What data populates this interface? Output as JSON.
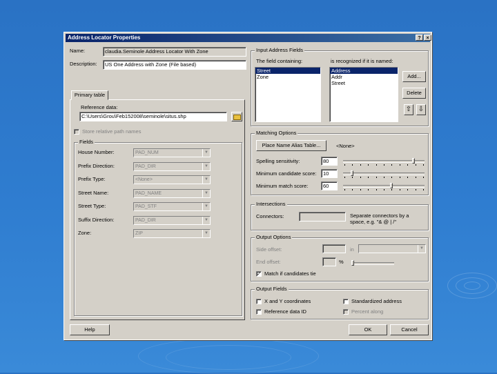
{
  "window": {
    "title": "Address Locator Properties",
    "help_btn": "?",
    "close_btn": "×"
  },
  "name": {
    "label": "Name:",
    "value": "claudia.Seminole Address Locator With Zone"
  },
  "description": {
    "label": "Description:",
    "value": "US One Address with Zone (File based)"
  },
  "tab": {
    "label": "Primary table"
  },
  "reference_data": {
    "label": "Reference data:",
    "value": "C:\\Users\\Grou\\Feb152008\\seminole\\situs.shp"
  },
  "store_relative": {
    "label": "Store relative path names"
  },
  "fields": {
    "title": "Fields",
    "rows": [
      {
        "label": "House Number:",
        "value": "PAD_NUM"
      },
      {
        "label": "Prefix Direction:",
        "value": "PAD_DIR"
      },
      {
        "label": "Prefix Type:",
        "value": "<None>"
      },
      {
        "label": "Street Name:",
        "value": "PAD_NAME"
      },
      {
        "label": "Street Type:",
        "value": "PAD_STF"
      },
      {
        "label": "Suffix Direction:",
        "value": "PAD_DIR"
      },
      {
        "label": "Zone:",
        "value": "ZIP"
      }
    ]
  },
  "input_address": {
    "title": "Input Address Fields",
    "col1_label": "The field containing:",
    "col2_label": "is recognized if it is named:",
    "list1": [
      "Street",
      "Zone"
    ],
    "list2": [
      "Address",
      "Addr",
      "Street"
    ],
    "add_btn": "Add...",
    "delete_btn": "Delete",
    "up_icon": "⇧",
    "down_icon": "⇩"
  },
  "matching": {
    "title": "Matching Options",
    "alias_btn": "Place Name Alias Table...",
    "alias_value": "<None>",
    "spelling": {
      "label": "Spelling sensitivity:",
      "value": "80",
      "level": 0.88
    },
    "candidate": {
      "label": "Minimum candidate score:",
      "value": "10",
      "level": 0.1
    },
    "match": {
      "label": "Minimum match score:",
      "value": "60",
      "level": 0.6
    }
  },
  "intersections": {
    "title": "Intersections",
    "connectors_label": "Connectors:",
    "hint": "Separate connectors by a space, e.g. \"& @ | /\""
  },
  "output_options": {
    "title": "Output Options",
    "side_offset_label": "Side offset:",
    "in_label": "in",
    "end_offset_label": "End offset:",
    "percent": "%",
    "match_if_tied": "Match if candidates tie"
  },
  "output_fields": {
    "title": "Output Fields",
    "xy": "X and Y coordinates",
    "standardized": "Standardized address",
    "ref_data_id": "Reference data ID",
    "percent_along": "Percent along"
  },
  "buttons": {
    "help": "Help",
    "ok": "OK",
    "cancel": "Cancel"
  }
}
